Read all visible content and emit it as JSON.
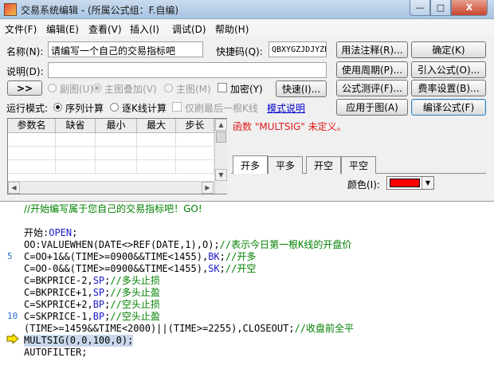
{
  "window": {
    "title": "交易系统编辑 - (所属公式组：F.自编)",
    "min": "—",
    "max": "□",
    "close": "X"
  },
  "menu": [
    "文件(F)",
    "编辑(E)",
    "查看(V)",
    "插入(I)",
    "调试(D)",
    "帮助(H)"
  ],
  "form": {
    "name_label": "名称(N):",
    "name_value": "请编写一个自己的交易指标吧",
    "shortcut_label": "快捷码(Q):",
    "shortcut_value": "QBXYGZJDJYZB",
    "desc_label": "说明(D):",
    "desc_value": "",
    "expand_btn": ">>",
    "opt_sub": "副图(U)",
    "opt_overlay": "主图叠加(V)",
    "opt_main": "主图(M)",
    "encrypt": "加密(Y)",
    "fast_btn": "快速(I)...",
    "runmode_label": "运行模式:",
    "mode_seq": "序列计算",
    "mode_bar": "逐K线计算",
    "mode_last": "仅刷最后一根K线",
    "mode_help": "模式说明"
  },
  "right_buttons": {
    "usage": "用法注释(R)...",
    "ok": "确定(K)",
    "period": "使用周期(P)...",
    "import": "引入公式(O)...",
    "test": "公式测评(F)...",
    "fee": "费率设置(B)...",
    "apply": "应用于图(A)",
    "compile": "编译公式(F)"
  },
  "param_table": {
    "headers": [
      "参数名",
      "缺省",
      "最小",
      "最大",
      "步长"
    ]
  },
  "error_message": "函数 \"MULTSIG\" 未定义。",
  "signal_tabs": [
    "开多",
    "平多",
    "开空",
    "平空"
  ],
  "color_label": "颜色(I):",
  "signal_color": "#ff0000",
  "editor": {
    "line_numbers": [
      "5",
      "10"
    ],
    "lines": [
      "//开始编写属于您自己的交易指标吧！GO!",
      "",
      "开始:OPEN;",
      "OO:VALUEWHEN(DATE<>REF(DATE,1),O);//表示今日第一根K线的开盘价",
      "C=OO+1&&(TIME>=0900&&TIME<1455),BK;//开多",
      "C=OO-0&&(TIME>=0900&&TIME<1455),SK;//开空",
      "C=BKPRICE-2,SP;//多头止损",
      "C=BKPRICE+1,SP;//多头止盈",
      "C=SKPRICE+2,BP;//空头止损",
      "C=SKPRICE-1,BP;//空头止盈",
      "(TIME>=1459&&TIME<2000)||(TIME>=2255),CLOSEOUT;//收盘前全平",
      "MULTSIG(0,0,100,0);",
      "AUTOFILTER;"
    ]
  }
}
